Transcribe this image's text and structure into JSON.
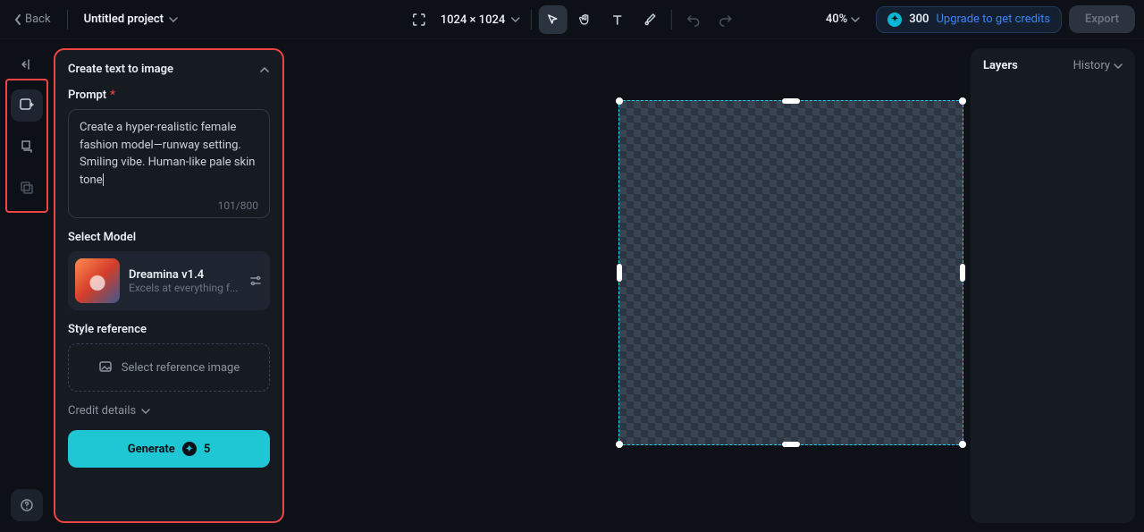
{
  "topbar": {
    "back_label": "Back",
    "project_title": "Untitled project",
    "dimensions": "1024 × 1024",
    "zoom": "40%",
    "credits_amount": "300",
    "upgrade_label": "Upgrade to get credits",
    "export_label": "Export"
  },
  "panel": {
    "title": "Create text to image",
    "prompt_label": "Prompt",
    "prompt_value": "Create a hyper-realistic female fashion model—runway setting. Smiling vibe. Human-like pale skin tone",
    "char_count": "101/800",
    "select_model_label": "Select Model",
    "model_name": "Dreamina v1.4",
    "model_desc": "Excels at everything f...",
    "style_reference_label": "Style reference",
    "style_placeholder": "Select reference image",
    "credit_details_label": "Credit details",
    "generate_label": "Generate",
    "generate_cost": "5"
  },
  "right": {
    "layers_title": "Layers",
    "history_label": "History"
  }
}
